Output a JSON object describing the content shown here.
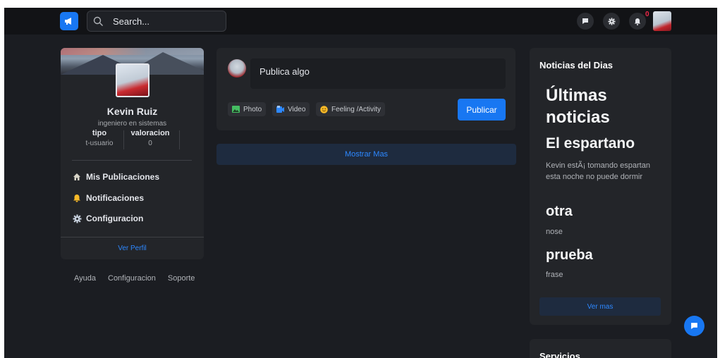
{
  "topbar": {
    "logo_icon": "megaphone-icon",
    "search_placeholder": "Search...",
    "notification_count": "0"
  },
  "profile": {
    "name": "Kevin Ruiz",
    "role": "ingeniero en sistemas",
    "stats": [
      {
        "label": "tipo",
        "value": "t-usuario"
      },
      {
        "label": "valoracion",
        "value": "0"
      }
    ],
    "menu": [
      {
        "label": "Mis Publicaciones",
        "icon": "home-icon"
      },
      {
        "label": "Notificaciones",
        "icon": "bell-icon"
      },
      {
        "label": "Configuracion",
        "icon": "gear-icon"
      }
    ],
    "view_profile": "Ver Perfil"
  },
  "footer_links": [
    "Ayuda",
    "Configuracion",
    "Soporte"
  ],
  "composer": {
    "placeholder": "Publica algo",
    "actions": [
      {
        "label": "Photo",
        "icon": "photo-icon",
        "color": "#45bd62"
      },
      {
        "label": "Video",
        "icon": "video-icon",
        "color": "#2d88ff"
      },
      {
        "label": "Feeling /Activity",
        "icon": "smile-icon",
        "color": "#f7b928"
      }
    ],
    "submit": "Publicar"
  },
  "feed": {
    "show_more": "Mostrar Mas"
  },
  "news": {
    "heading": "Noticias del Dias",
    "title": "Últimas noticias",
    "items": [
      {
        "title": "El espartano",
        "text": "Kevin estÃ¡ tomando espartan esta noche no puede dormir"
      },
      {
        "title": "otra",
        "text": "nose"
      },
      {
        "title": "prueba",
        "text": "frase"
      }
    ],
    "see_more": "Ver mas"
  },
  "services": {
    "heading": "Servicios"
  },
  "colors": {
    "accent": "#1877f2",
    "background": "#1b1d22",
    "card": "#232529",
    "topbar": "#121316"
  }
}
